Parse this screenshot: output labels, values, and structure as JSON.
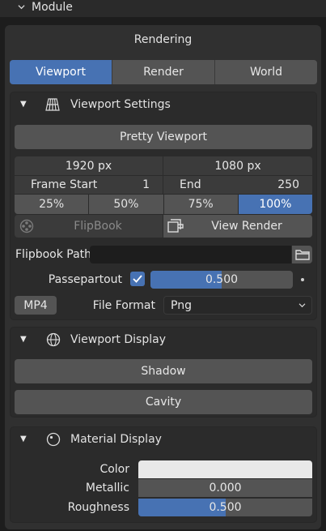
{
  "module": {
    "label": "Module"
  },
  "header": {
    "title": "Rendering"
  },
  "tabs": [
    {
      "label": "Viewport",
      "active": true
    },
    {
      "label": "Render",
      "active": false
    },
    {
      "label": "World",
      "active": false
    }
  ],
  "viewport_settings": {
    "title": "Viewport Settings",
    "pretty_button": "Pretty Viewport",
    "res_x": "1920 px",
    "res_y": "1080 px",
    "frame_start_label": "Frame Start",
    "frame_start_value": "1",
    "end_label": "End",
    "end_value": "250",
    "percents": [
      "25%",
      "50%",
      "75%",
      "100%"
    ],
    "active_percent_index": 3,
    "flipbook_button": "FlipBook",
    "view_render_button": "View Render",
    "flipbook_path_label": "Flipbook Path:",
    "flipbook_path_value": "",
    "passepartout_label": "Passepartout",
    "passepartout_checked": true,
    "passepartout_value": "0.500",
    "passepartout_fraction": 0.5,
    "mp4_button": "MP4",
    "file_format_label": "File Format",
    "file_format_value": "Png"
  },
  "viewport_display": {
    "title": "Viewport Display",
    "shadow_button": "Shadow",
    "cavity_button": "Cavity"
  },
  "material_display": {
    "title": "Material Display",
    "color_label": "Color",
    "color_value": "#e8e8e8",
    "metallic_label": "Metallic",
    "metallic_value": "0.000",
    "metallic_fraction": 0.0,
    "roughness_label": "Roughness",
    "roughness_value": "0.500",
    "roughness_fraction": 0.5
  },
  "colors": {
    "accent": "#4772b3",
    "panel": "#303030",
    "button": "#545454"
  }
}
